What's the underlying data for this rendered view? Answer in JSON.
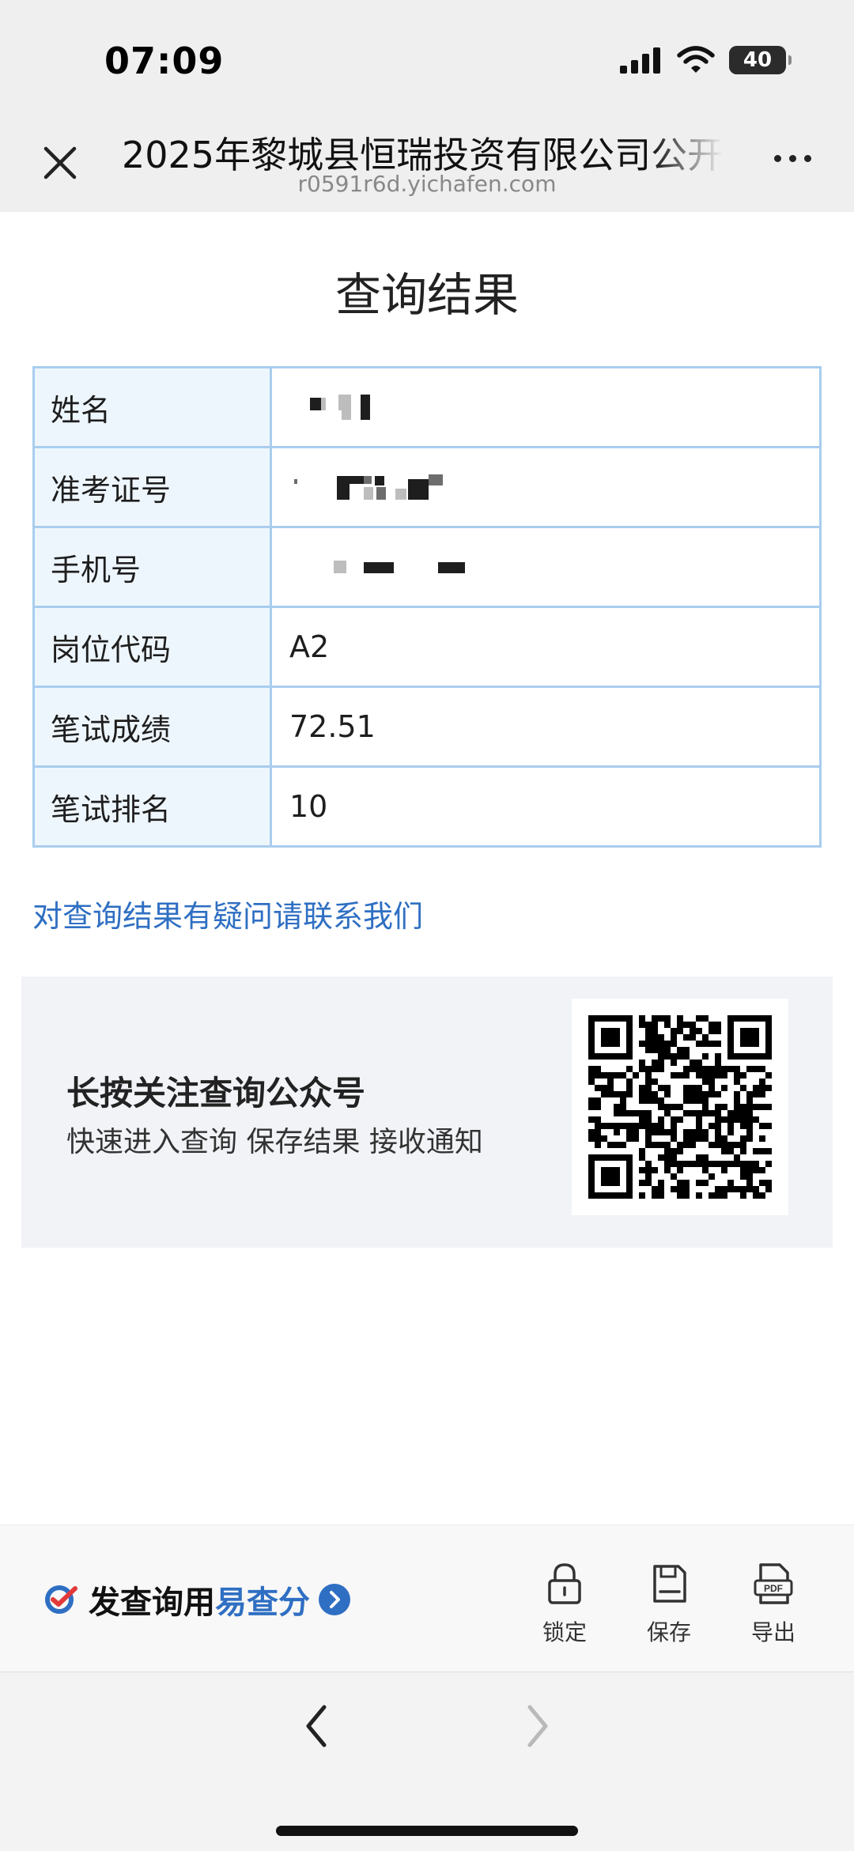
{
  "status_bar": {
    "time": "07:09",
    "battery": "40",
    "battery_level": 0.4,
    "icons": [
      "signal-bars-icon",
      "wifi-icon",
      "battery-icon"
    ]
  },
  "browser_header": {
    "title": "2025年黎城县恒瑞投资有限公司公开",
    "url": "r0591r6d.yichafen.com",
    "close_icon": "close-icon",
    "more_icon": "more-icon"
  },
  "page": {
    "heading": "查询结果",
    "rows": [
      {
        "label": "姓名",
        "value": "",
        "redacted": true
      },
      {
        "label": "准考证号",
        "value": "",
        "redacted": true
      },
      {
        "label": "手机号",
        "value": "",
        "redacted": true
      },
      {
        "label": "岗位代码",
        "value": "A2",
        "redacted": false
      },
      {
        "label": "笔试成绩",
        "value": "72.51",
        "redacted": false
      },
      {
        "label": "笔试排名",
        "value": "10",
        "redacted": false
      }
    ],
    "contact_link": "对查询结果有疑问请联系我们"
  },
  "follow_card": {
    "title": "长按关注查询公众号",
    "subtitle": "快速进入查询 保存结果 接收通知",
    "qr_icon": "qr-code-icon"
  },
  "bottom_bar": {
    "brand_prefix": "发查询用",
    "brand_highlight": "易查分",
    "brand_logo_icon": "yichafen-logo-icon",
    "tools": [
      {
        "label": "锁定",
        "icon": "lock-icon"
      },
      {
        "label": "保存",
        "icon": "save-icon"
      },
      {
        "label": "导出",
        "icon": "pdf-export-icon",
        "icon_text": "PDF"
      }
    ]
  },
  "browser_nav": {
    "back_icon": "chevron-left-icon",
    "forward_icon": "chevron-right-icon",
    "forward_enabled": false
  },
  "colors": {
    "accent": "#2f6fc3",
    "table_border": "#a9cdee",
    "label_bg": "#eef6fd",
    "card_bg": "#f1f3f7",
    "chrome_bg": "#efefef"
  }
}
